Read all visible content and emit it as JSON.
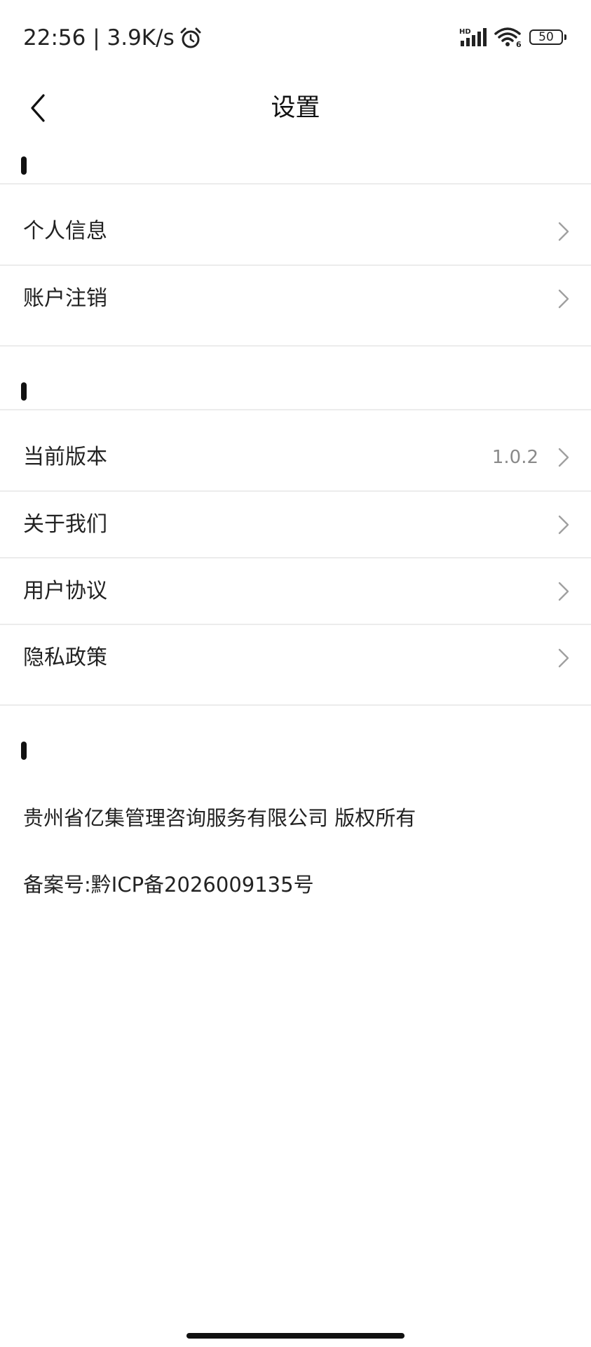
{
  "status_bar": {
    "time_speed": "22:56 | 3.9K/s",
    "network_badge": "HD",
    "wifi_badge": "6",
    "battery_level": "50"
  },
  "header": {
    "title": "设置"
  },
  "section1": {
    "items": [
      {
        "label": "个人信息"
      },
      {
        "label": "账户注销"
      }
    ]
  },
  "section2": {
    "items": [
      {
        "label": "当前版本",
        "value": "1.0.2"
      },
      {
        "label": "关于我们"
      },
      {
        "label": "用户协议"
      },
      {
        "label": "隐私政策"
      }
    ]
  },
  "footer": {
    "copyright": "贵州省亿集管理咨询服务有限公司 版权所有",
    "icp": "备案号:黔ICP备2026009135号"
  },
  "colors": {
    "text": "#222222",
    "muted": "#8a8a8a",
    "divider": "#ececec",
    "chevron": "#a0a0a0"
  }
}
